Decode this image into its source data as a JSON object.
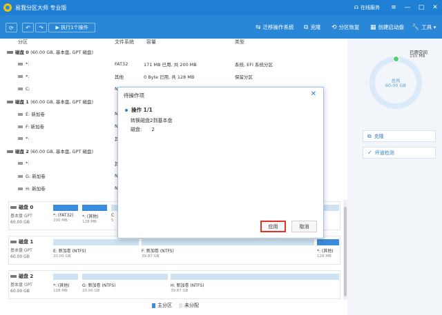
{
  "app": {
    "title": "易我分区大师 专业版",
    "online_service": "在线服务",
    "win_controls": [
      "≡",
      "—",
      "□",
      "✕"
    ]
  },
  "toolbar": {
    "refresh": "⟳",
    "undo": "↶",
    "redo": "↷",
    "execute": "▶ 执行1个操作",
    "tools": [
      {
        "icon": "⇆",
        "label": "迁移操作系统"
      },
      {
        "icon": "⧉",
        "label": "克隆"
      },
      {
        "icon": "⟲",
        "label": "分区恢复"
      },
      {
        "icon": "▦",
        "label": "创建启动盘"
      },
      {
        "icon": "🔧",
        "label": "工具 ▾"
      }
    ]
  },
  "table": {
    "headers": {
      "partition": "分区",
      "fs": "文件系统",
      "capacity": "容量",
      "type": "类型"
    },
    "rows": [
      {
        "kind": "disk",
        "name": "磁盘 0",
        "info": "(60.00 GB, 基本盘, GPT 磁盘)"
      },
      {
        "kind": "part",
        "name": "*:",
        "fs": "FAT32",
        "cap": "171 MB   已用, 共  200 MB",
        "type": "系统, EFI 系统分区"
      },
      {
        "kind": "part",
        "name": "*:",
        "fs": "其他",
        "cap": "0 Byte   已用, 共  128 MB",
        "type": "保留分区"
      },
      {
        "kind": "part",
        "name": "C:",
        "fs": "N",
        "cap": "",
        "type": ""
      },
      {
        "kind": "disk",
        "name": "磁盘 1",
        "info": "(60.00 GB, 基本盘, GPT 磁盘)"
      },
      {
        "kind": "part",
        "name": "E: 新加卷",
        "fs": "N",
        "cap": "",
        "type": ""
      },
      {
        "kind": "part",
        "name": "F: 新加卷",
        "fs": "N",
        "cap": "",
        "type": ""
      },
      {
        "kind": "part",
        "name": "*:",
        "fs": "其",
        "cap": "",
        "type": ""
      },
      {
        "kind": "disk",
        "name": "磁盘 2",
        "info": "(60.00 GB, 基本盘, GPT 磁盘)"
      },
      {
        "kind": "part",
        "name": "*:",
        "fs": "其",
        "cap": "",
        "type": ""
      },
      {
        "kind": "part",
        "name": "G: 新加卷",
        "fs": "N",
        "cap": "",
        "type": ""
      },
      {
        "kind": "part",
        "name": "H: 新加卷",
        "fs": "N",
        "cap": "",
        "type": ""
      }
    ]
  },
  "diskmap": [
    {
      "name": "磁盘 0",
      "type": "基本盘 GPT",
      "size": "60.00 GB",
      "segs": [
        {
          "label": "*: (FAT32)",
          "size": "200 MB",
          "used": true
        },
        {
          "label": "*: (其他)",
          "size": "128 MB",
          "used": true
        },
        {
          "label": "C",
          "size": "5",
          "used": false
        }
      ]
    },
    {
      "name": "磁盘 1",
      "type": "基本盘 GPT",
      "size": "60.00 GB",
      "segs": [
        {
          "label": "E: 新加卷 (NTFS)",
          "size": "20.00 GB",
          "used": false
        },
        {
          "label": "F: 新加卷 (NTFS)",
          "size": "39.87 GB",
          "used": false
        },
        {
          "label": "*: (其他)",
          "size": "128 MB",
          "used": true
        }
      ]
    },
    {
      "name": "磁盘 2",
      "type": "基本盘 GPT",
      "size": "60.00 GB",
      "segs": [
        {
          "label": "*: (其他)",
          "size": "128 MB",
          "used": true
        },
        {
          "label": "G: 新加卷 (NTFS)",
          "size": "20.00 GB",
          "used": false
        },
        {
          "label": "H: 新加卷 (NTFS)",
          "size": "39.87 GB",
          "used": false
        }
      ]
    }
  ],
  "legend": {
    "primary": "主分区",
    "unallocated": "未分配"
  },
  "right_panel": {
    "used_label": "已用空间",
    "used_value": "155 MB",
    "total_label": "总共",
    "total_value": "60.00 GB",
    "buttons": [
      {
        "icon": "⧉",
        "label": "克隆"
      },
      {
        "icon": "✓",
        "label": "坏道检测"
      }
    ]
  },
  "modal": {
    "title": "待操作项",
    "close": "✕",
    "op_label": "操作 1/1",
    "description": "转换磁盘2到基本盘",
    "disk_label": "磁盘:",
    "disk_value": "2",
    "apply": "应用",
    "cancel": "取消"
  },
  "colors": {
    "titlebar": "#1f7fd3",
    "toolbar": "#2a87d8",
    "used_bar": "#3a8ddc",
    "free_bar": "#cfe3f5",
    "apply_border": "#e0322b"
  }
}
